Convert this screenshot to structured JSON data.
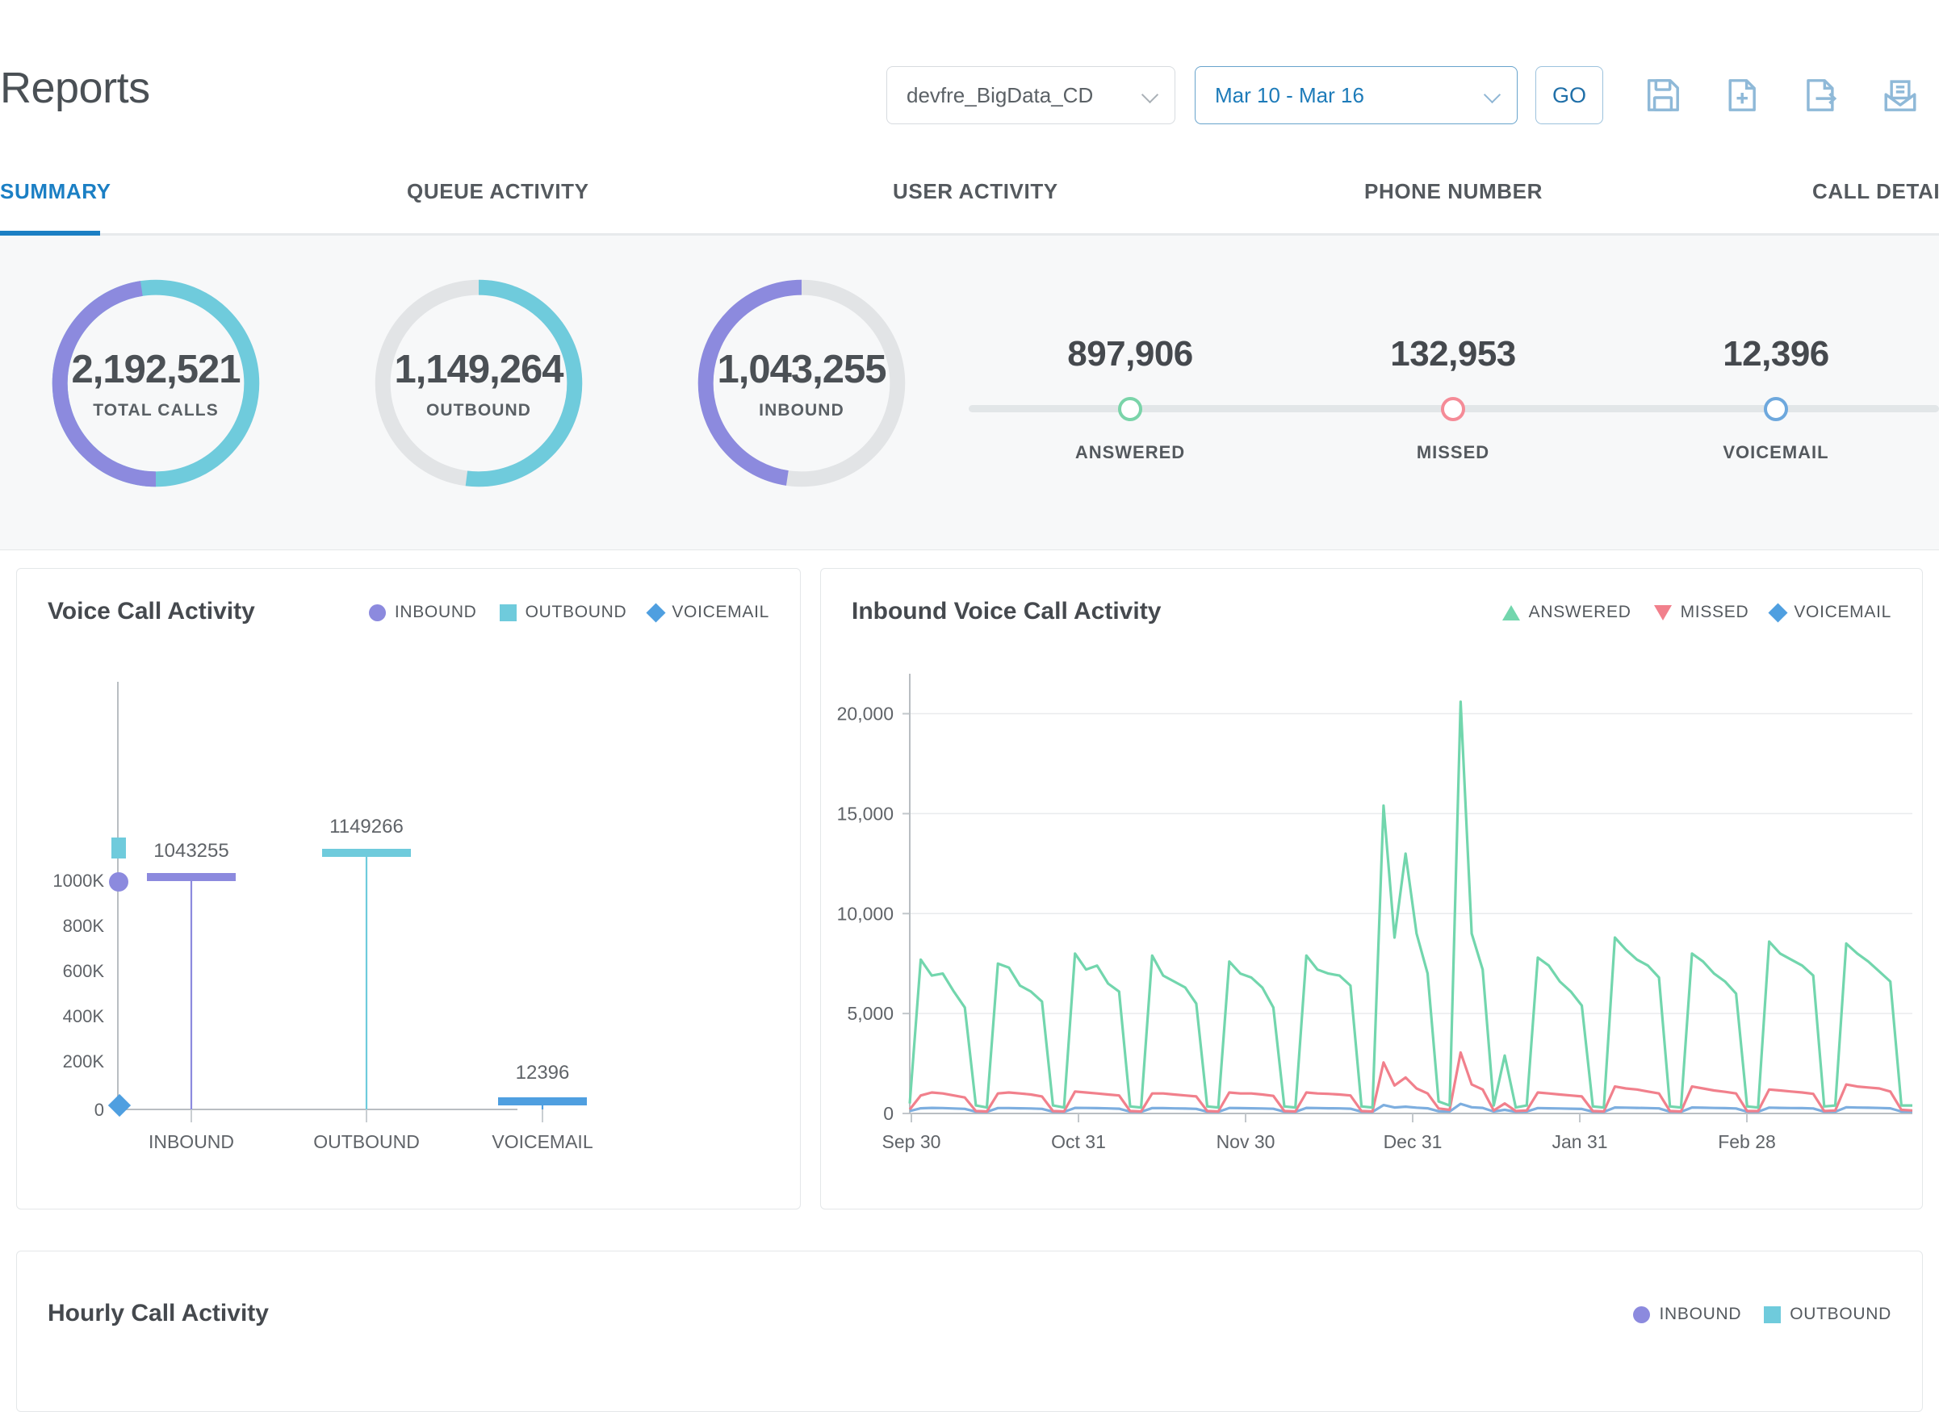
{
  "header": {
    "title": "Reports",
    "account_select": {
      "value": "devfre_BigData_CD"
    },
    "date_select": {
      "value": "Mar 10 - Mar 16"
    },
    "go_label": "GO",
    "icons": [
      "save-icon",
      "new-document-icon",
      "export-document-icon",
      "email-report-icon"
    ]
  },
  "tabs": [
    {
      "label": "SUMMARY",
      "active": true
    },
    {
      "label": "QUEUE ACTIVITY",
      "active": false
    },
    {
      "label": "USER ACTIVITY",
      "active": false
    },
    {
      "label": "PHONE NUMBER",
      "active": false
    },
    {
      "label": "CALL DETAIL",
      "active": false
    }
  ],
  "summary": {
    "donuts": [
      {
        "value": "2,192,521",
        "label": "TOTAL CALLS"
      },
      {
        "value": "1,149,264",
        "label": "OUTBOUND"
      },
      {
        "value": "1,043,255",
        "label": "INBOUND"
      }
    ],
    "stats": [
      {
        "value": "897,906",
        "label": "ANSWERED",
        "color": "#7ad4a9"
      },
      {
        "value": "132,953",
        "label": "MISSED",
        "color": "#f58b97"
      },
      {
        "value": "12,396",
        "label": "VOICEMAIL",
        "color": "#6ea8dd"
      }
    ]
  },
  "cards": {
    "voice_call_activity": {
      "title": "Voice Call Activity",
      "legend": [
        {
          "label": "INBOUND",
          "marker": "circle",
          "color": "#8c8ade"
        },
        {
          "label": "OUTBOUND",
          "marker": "square",
          "color": "#6fcbdc"
        },
        {
          "label": "VOICEMAIL",
          "marker": "diamond",
          "color": "#4f9fe0"
        }
      ]
    },
    "inbound_voice_call_activity": {
      "title": "Inbound Voice Call Activity",
      "legend": [
        {
          "label": "ANSWERED",
          "marker": "triangle-up",
          "color": "#72d6ad"
        },
        {
          "label": "MISSED",
          "marker": "triangle-down",
          "color": "#f1808c"
        },
        {
          "label": "VOICEMAIL",
          "marker": "diamond",
          "color": "#4f9fe0"
        }
      ]
    },
    "hourly_call_activity": {
      "title": "Hourly Call Activity",
      "legend": [
        {
          "label": "INBOUND",
          "marker": "circle",
          "color": "#8c8ade"
        },
        {
          "label": "OUTBOUND",
          "marker": "square",
          "color": "#6fcbdc"
        }
      ]
    }
  },
  "chart_data": [
    {
      "type": "bar",
      "title": "Voice Call Activity",
      "categories": [
        "INBOUND",
        "OUTBOUND",
        "VOICEMAIL"
      ],
      "values": [
        1043255,
        1149266,
        12396
      ],
      "data_labels": [
        "1043255",
        "1149266",
        "12396"
      ],
      "series": [
        {
          "name": "INBOUND",
          "values": [
            1043255
          ],
          "color": "#8c8ade",
          "marker": "circle"
        },
        {
          "name": "OUTBOUND",
          "values": [
            1149266
          ],
          "color": "#6fcbdc",
          "marker": "square"
        },
        {
          "name": "VOICEMAIL",
          "values": [
            12396
          ],
          "color": "#4f9fe0",
          "marker": "diamond"
        }
      ],
      "xlabel": "",
      "ylabel": "",
      "ylim": [
        0,
        1200000
      ],
      "yticks": [
        0,
        200000,
        400000,
        600000,
        800000,
        1000000
      ],
      "ytick_labels": [
        "0",
        "200K",
        "400K",
        "600K",
        "800K",
        "1000K"
      ],
      "grid": false,
      "legend_position": "top-right"
    },
    {
      "type": "line",
      "title": "Inbound Voice Call Activity",
      "xlabel": "",
      "ylabel": "",
      "ylim": [
        0,
        22000
      ],
      "yticks": [
        0,
        5000,
        10000,
        15000,
        20000
      ],
      "ytick_labels": [
        "0",
        "5,000",
        "10,000",
        "15,000",
        "20,000"
      ],
      "xtick_labels": [
        "Sep 30",
        "Oct 31",
        "Nov 30",
        "Dec 31",
        "Jan 31",
        "Feb 28"
      ],
      "grid": true,
      "legend_position": "top-right",
      "series": [
        {
          "name": "ANSWERED",
          "color": "#72d6ad",
          "values": [
            500,
            7700,
            6900,
            7000,
            6100,
            5300,
            400,
            300,
            7500,
            7300,
            6400,
            6100,
            5600,
            400,
            300,
            8000,
            7200,
            7400,
            6500,
            6100,
            350,
            300,
            7900,
            6900,
            6600,
            6300,
            5500,
            350,
            300,
            7600,
            7000,
            6800,
            6300,
            5300,
            350,
            300,
            7900,
            7200,
            7000,
            6900,
            6400,
            350,
            300,
            15400,
            8800,
            13000,
            9000,
            7000,
            600,
            400,
            20600,
            9000,
            7200,
            400,
            2900,
            300,
            400,
            7800,
            7400,
            6600,
            6100,
            5400,
            350,
            300,
            8800,
            8200,
            7700,
            7400,
            6800,
            350,
            300,
            8000,
            7600,
            7000,
            6600,
            6000,
            350,
            300,
            8600,
            8000,
            7700,
            7400,
            6900,
            350,
            400,
            8500,
            8000,
            7600,
            7100,
            6600,
            400,
            400
          ]
        },
        {
          "name": "MISSED",
          "color": "#f1808c",
          "values": [
            200,
            900,
            1050,
            1000,
            900,
            800,
            120,
            100,
            1000,
            1050,
            1000,
            950,
            850,
            120,
            100,
            1100,
            1050,
            1000,
            950,
            900,
            120,
            100,
            1000,
            1000,
            950,
            900,
            850,
            120,
            100,
            1050,
            1000,
            1000,
            950,
            880,
            120,
            100,
            1050,
            1000,
            980,
            950,
            900,
            120,
            100,
            2550,
            1400,
            1800,
            1250,
            1000,
            250,
            180,
            3050,
            1450,
            1200,
            150,
            500,
            120,
            150,
            1050,
            1000,
            950,
            900,
            850,
            120,
            100,
            1350,
            1250,
            1200,
            1100,
            1000,
            120,
            100,
            1350,
            1250,
            1150,
            1080,
            1000,
            120,
            120,
            1200,
            1150,
            1100,
            1050,
            980,
            120,
            150,
            1450,
            1350,
            1300,
            1250,
            1100,
            180,
            150
          ]
        },
        {
          "name": "VOICEMAIL",
          "color": "#7daedf",
          "values": [
            120,
            260,
            280,
            270,
            250,
            230,
            90,
            80,
            270,
            270,
            260,
            250,
            230,
            90,
            80,
            280,
            275,
            265,
            255,
            240,
            90,
            80,
            270,
            265,
            255,
            245,
            230,
            90,
            80,
            275,
            265,
            260,
            250,
            235,
            90,
            80,
            280,
            270,
            260,
            255,
            240,
            90,
            80,
            420,
            300,
            340,
            290,
            260,
            110,
            95,
            480,
            310,
            280,
            95,
            180,
            85,
            95,
            270,
            260,
            250,
            240,
            225,
            90,
            80,
            300,
            290,
            280,
            270,
            255,
            90,
            80,
            300,
            285,
            275,
            265,
            250,
            90,
            85,
            290,
            280,
            270,
            265,
            250,
            90,
            90,
            310,
            295,
            285,
            275,
            260,
            95,
            90
          ]
        }
      ]
    }
  ]
}
